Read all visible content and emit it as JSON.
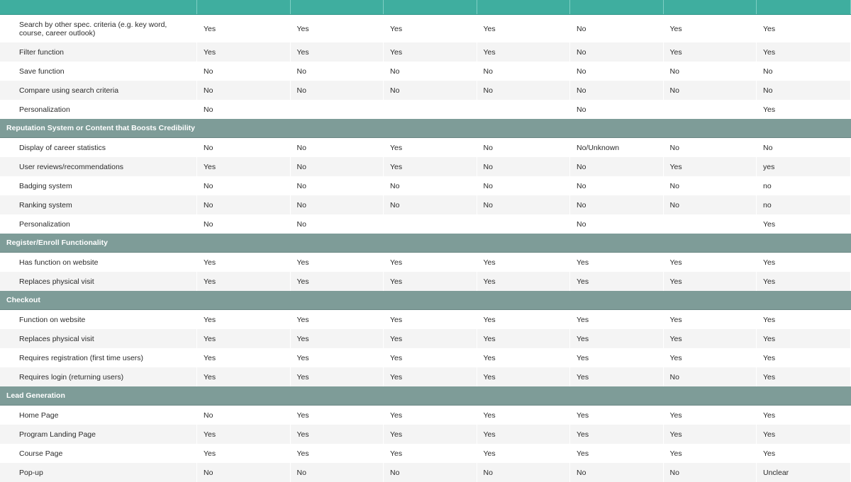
{
  "groups": [
    {
      "title": null,
      "rows": [
        {
          "label": "Search by other spec. criteria (e.g. key word, course, career outlook)",
          "values": [
            "Yes",
            "Yes",
            "Yes",
            "Yes",
            "No",
            "Yes",
            "Yes"
          ]
        },
        {
          "label": "Filter function",
          "values": [
            "Yes",
            "Yes",
            "Yes",
            "Yes",
            "No",
            "Yes",
            "Yes"
          ]
        },
        {
          "label": "Save function",
          "values": [
            "No",
            "No",
            "No",
            "No",
            "No",
            "No",
            "No"
          ]
        },
        {
          "label": "Compare using search criteria",
          "values": [
            "No",
            "No",
            "No",
            "No",
            "No",
            "No",
            "No"
          ]
        },
        {
          "label": "Personalization",
          "values": [
            "No",
            "",
            "",
            "",
            "No",
            "",
            "Yes"
          ]
        }
      ]
    },
    {
      "title": "Reputation System or Content that Boosts Credibility",
      "rows": [
        {
          "label": "Display of career statistics",
          "values": [
            "No",
            "No",
            "Yes",
            "No",
            "No/Unknown",
            "No",
            "No"
          ]
        },
        {
          "label": "User reviews/recommendations",
          "values": [
            "Yes",
            "No",
            "Yes",
            "No",
            "No",
            "Yes",
            "yes"
          ]
        },
        {
          "label": "Badging system",
          "values": [
            "No",
            "No",
            "No",
            "No",
            "No",
            "No",
            "no"
          ]
        },
        {
          "label": "Ranking system",
          "values": [
            "No",
            "No",
            "No",
            "No",
            "No",
            "No",
            "no"
          ]
        },
        {
          "label": "Personalization",
          "values": [
            "No",
            "No",
            "",
            "",
            "No",
            "",
            "Yes"
          ]
        }
      ]
    },
    {
      "title": "Register/Enroll Functionality",
      "rows": [
        {
          "label": "Has function on website",
          "values": [
            "Yes",
            "Yes",
            "Yes",
            "Yes",
            "Yes",
            "Yes",
            "Yes"
          ]
        },
        {
          "label": "Replaces physical visit",
          "values": [
            "Yes",
            "Yes",
            "Yes",
            "Yes",
            "Yes",
            "Yes",
            "Yes"
          ]
        }
      ]
    },
    {
      "title": "Checkout",
      "rows": [
        {
          "label": "Function on website",
          "values": [
            "Yes",
            "Yes",
            "Yes",
            "Yes",
            "Yes",
            "Yes",
            "Yes"
          ]
        },
        {
          "label": "Replaces physical visit",
          "values": [
            "Yes",
            "Yes",
            "Yes",
            "Yes",
            "Yes",
            "Yes",
            "Yes"
          ]
        },
        {
          "label": "Requires registration (first time users)",
          "values": [
            "Yes",
            "Yes",
            "Yes",
            "Yes",
            "Yes",
            "Yes",
            "Yes"
          ]
        },
        {
          "label": "Requires login (returning users)",
          "values": [
            "Yes",
            "Yes",
            "Yes",
            "Yes",
            "Yes",
            "No",
            "Yes"
          ]
        }
      ]
    },
    {
      "title": "Lead Generation",
      "rows": [
        {
          "label": "Home Page",
          "values": [
            "No",
            "Yes",
            "Yes",
            "Yes",
            "Yes",
            "Yes",
            "Yes"
          ]
        },
        {
          "label": "Program Landing Page",
          "values": [
            "Yes",
            "Yes",
            "Yes",
            "Yes",
            "Yes",
            "Yes",
            "Yes"
          ]
        },
        {
          "label": "Course Page",
          "values": [
            "Yes",
            "Yes",
            "Yes",
            "Yes",
            "Yes",
            "Yes",
            "Yes"
          ]
        },
        {
          "label": "Pop-up",
          "values": [
            "No",
            "No",
            "No",
            "No",
            "No",
            "No",
            "Unclear"
          ]
        }
      ]
    }
  ]
}
